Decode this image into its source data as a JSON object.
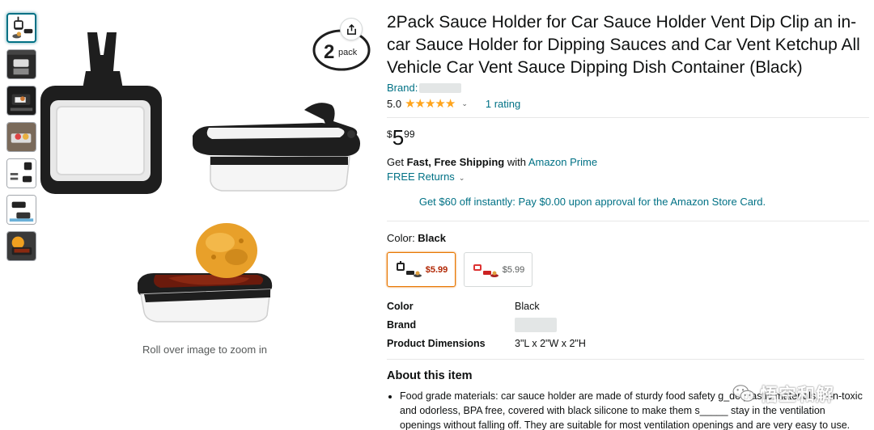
{
  "product": {
    "title": "2Pack Sauce Holder for Car Sauce Holder Vent Dip Clip an in-car Sauce Holder for Dipping Sauces and Car Vent Ketchup All Vehicle Car Vent Sauce Dipping Dish Container (Black)",
    "brand_label": "Brand:",
    "rating_value": "5.0",
    "stars": "★★★★★",
    "rating_count": "1 rating",
    "price_symbol": "$",
    "price_whole": "5",
    "price_fraction": "99",
    "shipping_prefix": "Get ",
    "shipping_bold": "Fast, Free Shipping",
    "shipping_mid": " with ",
    "shipping_link": "Amazon Prime",
    "returns_label": "FREE Returns",
    "promo": "Get $60 off instantly: Pay $0.00 upon approval for the Amazon Store Card.",
    "color_label": "Color: ",
    "color_value": "Black",
    "swatches": [
      {
        "price": "$5.99",
        "selected": true
      },
      {
        "price": "$5.99",
        "selected": false
      }
    ],
    "specs": [
      {
        "key": "Color",
        "value": "Black"
      },
      {
        "key": "Brand",
        "value": ""
      },
      {
        "key": "Product Dimensions",
        "value": "3\"L x 2\"W x 2\"H"
      }
    ],
    "about_heading": "About this item",
    "bullets": [
      "Food grade materials: car sauce holder are made of sturdy food safety g_de plastic materials, non-toxic and odorless, BPA free, covered with black silicone to make them s_____ stay in the ventilation openings without falling off. They are suitable for most ventilation openings and are very easy to use."
    ]
  },
  "gallery": {
    "zoom_hint": "Roll over image to zoom in",
    "badge_number": "2",
    "badge_text": "pack",
    "thumbnail_count": 7
  },
  "watermark": {
    "text": "悟空和解"
  },
  "colors": {
    "link": "#007185",
    "star": "#ffa41c",
    "price_red": "#b12704",
    "selected_border": "#e77600"
  }
}
